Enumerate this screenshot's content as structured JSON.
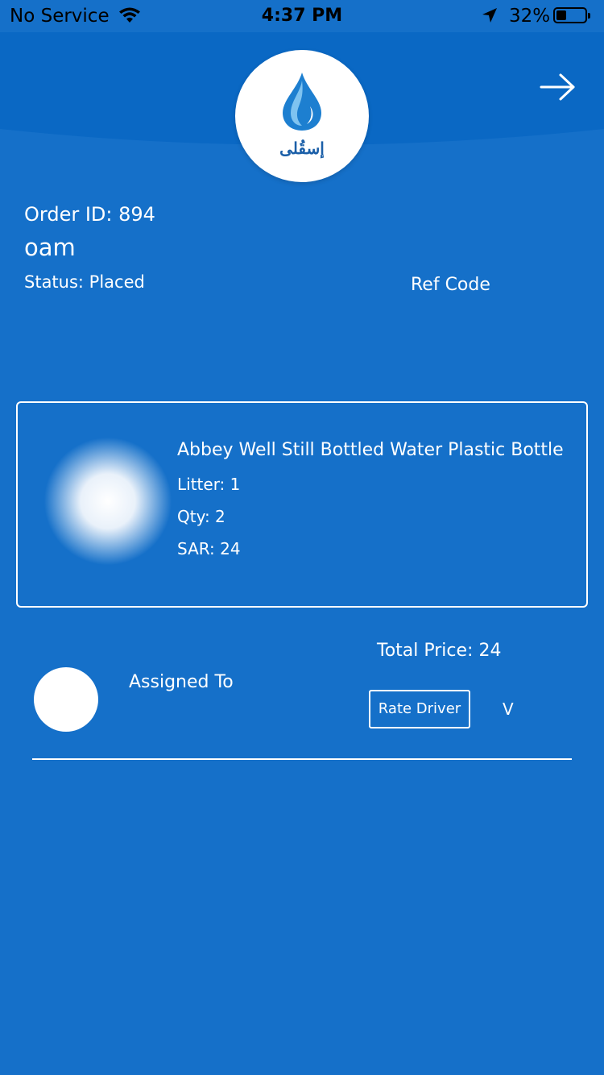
{
  "status_bar": {
    "carrier": "No Service",
    "time": "4:37 PM",
    "battery": "32%"
  },
  "header": {
    "logo_text": "إسقُلى",
    "icons": {
      "logo": "water-drop-icon",
      "next": "arrow-right-icon"
    }
  },
  "order": {
    "id_label": "Order ID: 894",
    "customer_name": "oam",
    "status_label": "Status: Placed",
    "ref_code_label": "Ref Code"
  },
  "product": {
    "name": "Abbey Well Still Bottled Water Plastic Bottle",
    "litter": "Litter: 1",
    "qty": "Qty: 2",
    "price": "SAR: 24"
  },
  "summary": {
    "total_price": "Total Price: 24",
    "assigned_to": "Assigned To",
    "rate_driver": "Rate Driver",
    "toggle": "V"
  },
  "colors": {
    "background": "#1570c9",
    "header": "#0a68c4",
    "text": "#ffffff"
  }
}
